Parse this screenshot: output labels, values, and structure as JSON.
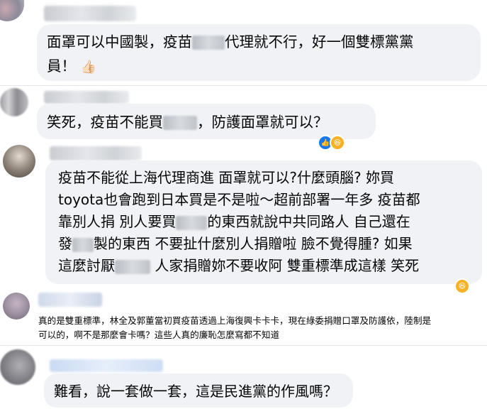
{
  "comments": [
    {
      "line1_a": "面罩可以中國製，疫苗",
      "line1_b": "代理就不行，好一個雙標黨黨",
      "line2": "員！",
      "emoji": "👍🏻"
    },
    {
      "line1_a": "笑死，疫苗不能買",
      "line1_b": "，防護面罩就可以？",
      "reaction_icons": [
        "like-icon",
        "haha-icon"
      ]
    },
    {
      "line1": "疫苗不能從上海代理商進 面罩就可以?什麼頭腦? 妳買",
      "line2": "toyota也會跑到日本買是不是啦～超前部署一年多 疫苗都",
      "line3_a": "靠別人捐 別人要買",
      "line3_b": "的東西就說中共同路人 自己還在",
      "line4_a": "發",
      "line4_b": "製的東西 不要扯什麼別人捐贈啦 臉不覺得腫? 如果",
      "line5_a": "這麼討厭",
      "line5_b": " 人家捐贈妳不要收阿 雙重標準成這樣 笑死",
      "reaction_icons": [
        "haha-icon"
      ]
    },
    {
      "line1": "真的是雙重標準，林全及郭董當初買疫苗透過上海復興卡卡卡，現在綠委捐贈口罩及防護依，陸制是",
      "line2": "可以的，啊不是那麼會卡嗎？這些人真的廉恥怎麼寫都不知道"
    },
    {
      "line1": "難看，說一套做一套，這是民進黨的作風嗎？"
    }
  ],
  "colors": {
    "bubble": "#f0f2f5",
    "text": "#050505",
    "like_blue": "#1877f2",
    "haha_yellow": "#f7b125"
  }
}
